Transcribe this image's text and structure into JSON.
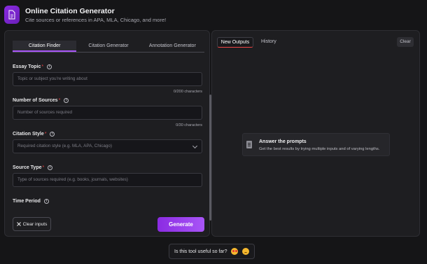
{
  "header": {
    "title": "Online Citation Generator",
    "subtitle": "Cite sources or references in APA, MLA, Chicago, and more!",
    "icon": "document-icon",
    "accent": "#8a2be2"
  },
  "tabs": [
    "Citation Finder",
    "Citation Generator",
    "Annotation Generator"
  ],
  "form": {
    "essay_topic": {
      "label": "Essay Topic",
      "placeholder": "Topic or subject you're writing about",
      "counter": "0/200 characters"
    },
    "number_of_sources": {
      "label": "Number of Sources",
      "placeholder": "Number of sources required",
      "counter": "0/30 characters"
    },
    "citation_style": {
      "label": "Citation Style",
      "placeholder": "Required citation style (e.g. MLA, APA, Chicago)"
    },
    "source_type": {
      "label": "Source Type",
      "placeholder": "Type of sources required (e.g. books, journals, websites)"
    },
    "time_period": {
      "label": "Time Period"
    },
    "required_mark": "*"
  },
  "buttons": {
    "clear_inputs": "Clear inputs",
    "generate": "Generate"
  },
  "output": {
    "tab_new": "New Outputs",
    "tab_history": "History",
    "clear": "Clear",
    "prompt_title": "Answer the prompts",
    "prompt_desc": "Get the best results by trying multiple inputs and of varying lengths."
  },
  "feedback": {
    "text": "Is this tool useful so far?"
  }
}
